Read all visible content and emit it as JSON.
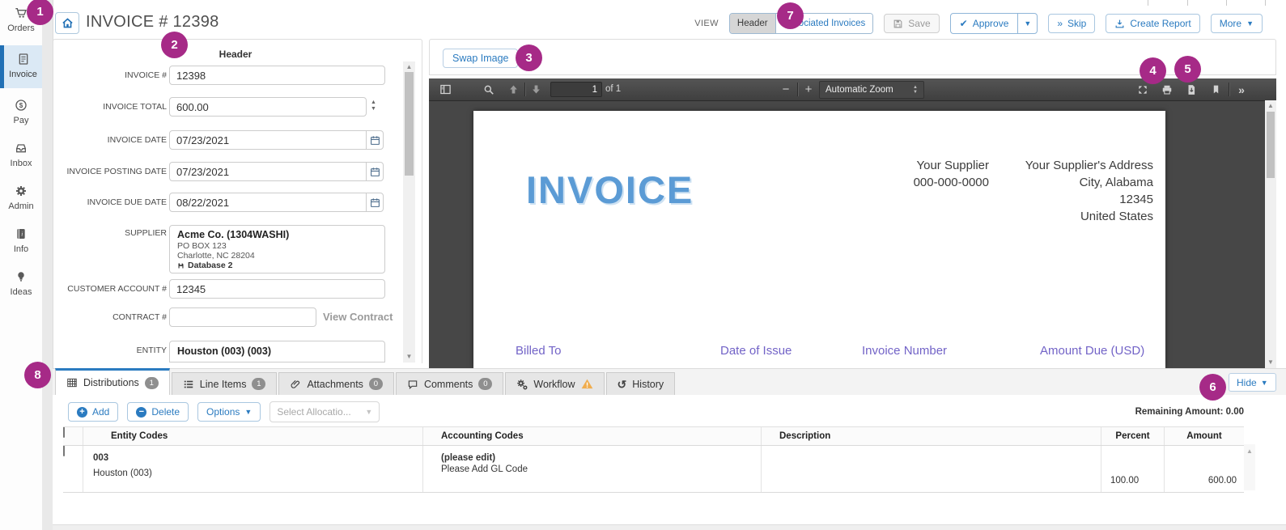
{
  "colors": {
    "accent": "#2b7bc0",
    "annotation": "#a62a87",
    "warning": "#f0ad4e",
    "doc_blue": "#5b9bd5",
    "doc_purple": "#7263c7"
  },
  "annotations": {
    "items": [
      "1",
      "2",
      "3",
      "4",
      "5",
      "6",
      "7",
      "8"
    ]
  },
  "sidebar": {
    "items": [
      {
        "label": "Orders",
        "icon": "cart-icon"
      },
      {
        "label": "Invoice",
        "icon": "invoice-icon",
        "selected": true
      },
      {
        "label": "Pay",
        "icon": "dollar-icon"
      },
      {
        "label": "Inbox",
        "icon": "inbox-icon"
      },
      {
        "label": "Admin",
        "icon": "gear-icon"
      },
      {
        "label": "Info",
        "icon": "info-icon"
      },
      {
        "label": "Ideas",
        "icon": "lightbulb-icon"
      }
    ]
  },
  "header": {
    "title": "INVOICE # 12398"
  },
  "actions": {
    "view_label": "VIEW",
    "view_options": [
      "Header",
      "Associated Invoices"
    ],
    "view_selected": "Header",
    "save": "Save",
    "approve": "Approve",
    "skip": "Skip",
    "create_report": "Create Report",
    "more": "More"
  },
  "form": {
    "section_title": "Header",
    "invoice_no": {
      "label": "INVOICE #",
      "value": "12398"
    },
    "invoice_total": {
      "label": "INVOICE TOTAL",
      "value": "600.00"
    },
    "invoice_date": {
      "label": "INVOICE DATE",
      "value": "07/23/2021"
    },
    "invoice_posting_date": {
      "label": "INVOICE POSTING DATE",
      "value": "07/23/2021"
    },
    "invoice_due_date": {
      "label": "INVOICE DUE DATE",
      "value": "08/22/2021"
    },
    "supplier": {
      "label": "SUPPLIER",
      "name": "Acme Co. (1304WASHI)",
      "line1": "PO BOX 123",
      "line2": "Charlotte, NC 28204",
      "database": "Database 2"
    },
    "customer_account": {
      "label": "CUSTOMER ACCOUNT #",
      "value": "12345"
    },
    "contract": {
      "label": "CONTRACT #",
      "value": "",
      "link": "View Contract"
    },
    "entity": {
      "label": "ENTITY",
      "value": "Houston (003) (003)"
    }
  },
  "image_panel": {
    "swap_button": "Swap Image",
    "pdf": {
      "page_value": "1",
      "page_of": "of 1",
      "zoom_label": "Automatic Zoom"
    },
    "doc": {
      "title": "INVOICE",
      "supplier_name": "Your Supplier",
      "supplier_phone": "000-000-0000",
      "address": [
        "Your Supplier's Address",
        "City, Alabama",
        "12345",
        "United States"
      ],
      "columns": [
        "Billed To",
        "Date of Issue",
        "Invoice Number",
        "Amount Due (USD)"
      ]
    }
  },
  "tabs": {
    "items": [
      {
        "label": "Distributions",
        "badge": "1"
      },
      {
        "label": "Line Items",
        "badge": "1"
      },
      {
        "label": "Attachments",
        "badge": "0"
      },
      {
        "label": "Comments",
        "badge": "0"
      },
      {
        "label": "Workflow"
      },
      {
        "label": "History"
      }
    ],
    "hide": "Hide"
  },
  "distributions": {
    "add": "Add",
    "delete": "Delete",
    "options": "Options",
    "allocation_placeholder": "Select Allocatio...",
    "remaining_label": "Remaining Amount: 0.00",
    "columns": [
      "Entity Codes",
      "Accounting Codes",
      "Description",
      "Percent",
      "Amount"
    ],
    "row": {
      "entity_code": "003",
      "entity_name": "Houston (003)",
      "accounting_status": "(please edit)",
      "accounting_note": "Please Add GL Code",
      "description": "",
      "percent": "100.00",
      "amount": "600.00"
    }
  }
}
